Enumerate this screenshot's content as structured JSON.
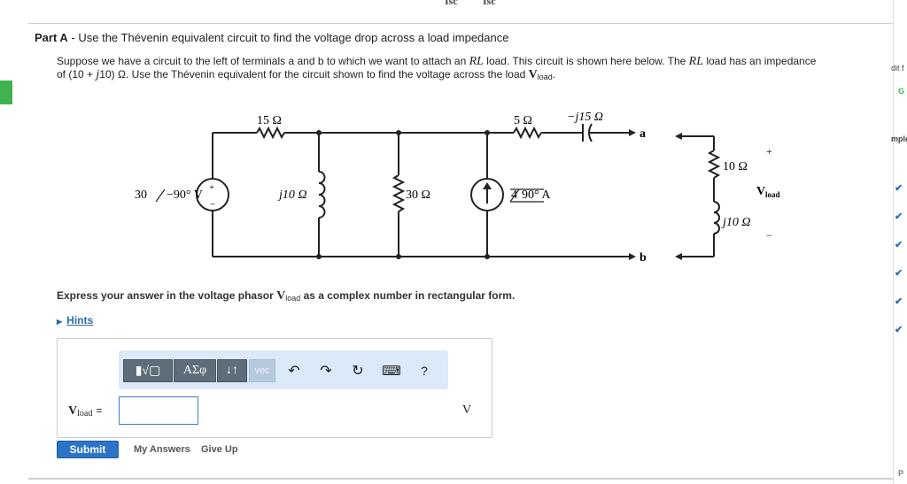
{
  "top_fragments": [
    "Isc",
    "Isc"
  ],
  "part": {
    "label": "Part A",
    "title": " - Use the Thévenin equivalent circuit to find the voltage drop across a load impedance"
  },
  "problem": {
    "text1": "Suppose we have a circuit to the left of terminals a and b to which we want to attach an ",
    "rl1": "RL",
    "text2": " load. This circuit is shown here below. The ",
    "rl2": "RL",
    "text3": " load has an impedance",
    "text4": "of (10 + ",
    "j": "j",
    "text5": "10) Ω. Use the Thévenin equivalent for the circuit shown to find the voltage across the load ",
    "vload_main": "V",
    "vload_sub": "load",
    "text6": "."
  },
  "circuit": {
    "r15": "15 Ω",
    "r5": "5 Ω",
    "cap": "−j15 Ω",
    "source_v": "30",
    "source_v_angle": "−90° V",
    "plus": "+",
    "minus": "−",
    "l10": "j10 Ω",
    "r30": "30 Ω",
    "source_i": "4",
    "source_i_angle": "90° A",
    "terminal_a": "a",
    "terminal_b": "b",
    "load_r": "10 Ω",
    "load_l": "j10 Ω",
    "load_plus": "+",
    "load_minus": "−",
    "load_v": "V",
    "load_v_sub": "load"
  },
  "express": {
    "pre": "Express your answer in the voltage phasor ",
    "v": "V",
    "v_sub": "load",
    "post": " as a complex number in rectangular form."
  },
  "hints": {
    "label": "Hints"
  },
  "toolbar": {
    "templates": "▮√▢",
    "greek": "ΑΣφ",
    "sort": "↓↑",
    "vec": "vec",
    "undo": "↶",
    "redo": "↷",
    "reset": "↻",
    "keyboard": "⌨",
    "help": "?"
  },
  "answer": {
    "label_main": "V",
    "label_sub": "load",
    "eq": "=",
    "value": "",
    "unit": "V"
  },
  "actions": {
    "submit": "Submit",
    "my_answers": "My Answers",
    "give_up": "Give Up"
  },
  "right_panel": {
    "edit": "dit f",
    "g": "G",
    "sample": "mple",
    "p": "P",
    "checks": [
      "✔",
      "✔",
      "✔",
      "✔",
      "✔",
      "✔"
    ]
  },
  "colors": {
    "accent_green": "#3fb34f",
    "submit_blue": "#2b74c6",
    "link_blue": "#2d6ca6",
    "toolbar_bg": "#dbe9f9"
  }
}
